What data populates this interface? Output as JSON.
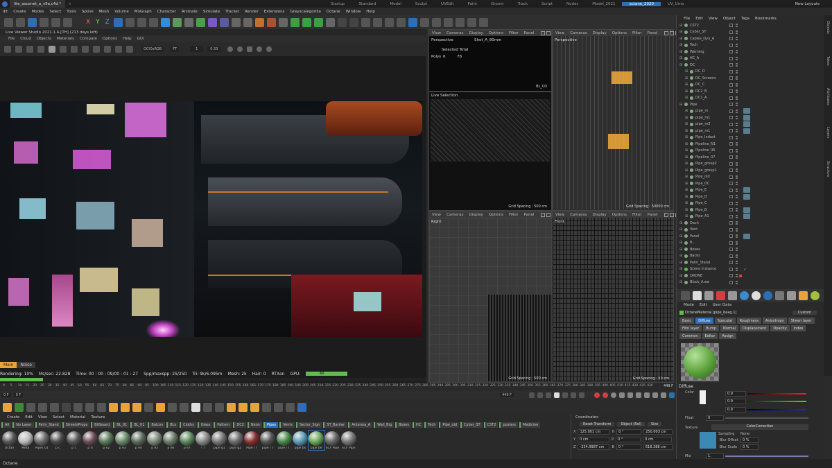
{
  "titlebar": {
    "file_tab": "lite_ascenet_a_v9a.c4d *",
    "layouts": [
      "Startup",
      "Standard",
      "Model",
      "Sculpt",
      "UVEdit",
      "Paint",
      "Groom",
      "Track",
      "Script",
      "Nodes",
      "Model_2021",
      "octane_2020",
      "UV_Uma"
    ],
    "active_layout": "octane_2020",
    "new_layouts": "New Layouts"
  },
  "main_menu": [
    "dit",
    "Create",
    "Modes",
    "Select",
    "Tools",
    "Spline",
    "Mesh",
    "Volume",
    "MoGraph",
    "Character",
    "Animate",
    "Simulate",
    "Tracker",
    "Render",
    "Extensions",
    "Greyscalegorilla",
    "Octane",
    "Window",
    "Help"
  ],
  "live_viewer": {
    "title": "Live Viewer Studio 2021.1.4-[TH] (213 days left)",
    "menu": [
      "File",
      "Cloud",
      "Objects",
      "Materials",
      "Compare",
      "Options",
      "Help",
      "GUI"
    ],
    "colorspace": "OCIOsRGB",
    "mode": "FT",
    "value1": "1",
    "value2": "0.33",
    "tabs": [
      "Main",
      "Noise"
    ],
    "status": {
      "rendering": "Rendering: 10%",
      "ms": "Ms/sec: 22.828",
      "time": "Time: 00 : 00 : 09/00 : 01 : 27",
      "spp": "Spp/maxspp: 25/250",
      "tri": "Tri: 9k/6.095m",
      "mesh": "Mesh: 2k",
      "hair": "Hair: 0",
      "rtx": "RTXon",
      "gpu": "GPU:",
      "gpu_val": "60"
    }
  },
  "viewports": {
    "menu": [
      "View",
      "Cameras",
      "Display",
      "Options",
      "Filter",
      "Panel"
    ],
    "tl": {
      "label": "Perspective",
      "camera": "Shot_A_80mm",
      "sel_title": "Selected Total",
      "polys": "Polys",
      "polys_a": "6",
      "polys_b": "78",
      "corner": "BL_O3"
    },
    "tl2": {
      "label": "Live Selection",
      "grid": "Grid Spacing : 500 cm"
    },
    "tr": {
      "label": "Perspective",
      "grid": "Grid Spacing : 50000 cm"
    },
    "bl": {
      "label": "Right",
      "grid": "Grid Spacing : 500 cm"
    },
    "br": {
      "label": "Front",
      "grid": "Grid Spacing : 50 cm"
    }
  },
  "object_manager": {
    "menu": [
      "File",
      "Edit",
      "View",
      "Object",
      "Tags",
      "Bookmarks"
    ],
    "objects": [
      "CST2",
      "Cyber_ST",
      "Cables_Dyn_A",
      "Tech",
      "Warning",
      "HC_A",
      "DC",
      "DC_D",
      "DC_Screens",
      "DC_C",
      "DC2_B",
      "DC2_A",
      "Pipe",
      "pipe_m",
      "pipe_m1",
      "pipe_m3",
      "pipe_m1",
      "Pipe_Indust",
      "Pipeline_N1",
      "Pipeline_06",
      "Pipeline_07",
      "Pipe_group2",
      "Pipe_group1",
      "Pipe_old",
      "Pipe_OC",
      "Pipe_E",
      "Pipe_D",
      "Pipe_C",
      "Pipe_B",
      "Pipe_A1",
      "Dach",
      "Vent",
      "Panel",
      "8...",
      "Boxes",
      "Backs",
      "Palm_Stand",
      "Scene Instance",
      "ORDNE",
      "Block_A.ew"
    ]
  },
  "side_tabs": [
    "Objects",
    "Takes",
    "Attributes",
    "Layers",
    "Structure"
  ],
  "timeline": {
    "ticks": [
      "0",
      "5",
      "10",
      "15",
      "20",
      "25",
      "30",
      "35",
      "40",
      "45",
      "50",
      "55",
      "60",
      "65",
      "70",
      "75",
      "80",
      "85",
      "90",
      "95",
      "100",
      "105",
      "110",
      "115",
      "120",
      "125",
      "130",
      "135",
      "140",
      "145",
      "150",
      "155",
      "160",
      "165",
      "170",
      "175",
      "180",
      "185",
      "190",
      "195",
      "200",
      "205",
      "210",
      "215",
      "220",
      "225",
      "230",
      "235",
      "240",
      "245",
      "250",
      "255",
      "260",
      "265",
      "270",
      "275",
      "280",
      "285",
      "290",
      "295",
      "300",
      "305",
      "310",
      "315",
      "320",
      "325",
      "330",
      "335",
      "340",
      "345",
      "350",
      "355",
      "360",
      "365",
      "370",
      "375",
      "380",
      "385",
      "390",
      "395",
      "400",
      "405",
      "410",
      "415",
      "420",
      "425",
      "430"
    ],
    "current": "449 F",
    "current2": "449 F",
    "start": "0 F",
    "start2": "0 F"
  },
  "material_manager": {
    "menu": [
      "Create",
      "Edit",
      "View",
      "Select",
      "Material",
      "Texture"
    ],
    "layers": [
      "All",
      "No Layer",
      "Palm_Stand",
      "StreetsProps",
      "Billboard",
      "BL_01",
      "BL_01",
      "Balcon",
      "BLs",
      "Cloths",
      "Glass",
      "Pattern",
      "DC2",
      "Neon",
      "Pipes",
      "Vents",
      "Sector_Sign",
      "ST_Barrier",
      "Antenna_A",
      "Wall_Big",
      "Boxes",
      "HC",
      "Tech",
      "Pipe_old",
      "Cyber_ST",
      "CST2",
      "posters",
      "Medicine"
    ],
    "active_layer": "Pipes",
    "materials": [
      {
        "name": "Octan",
        "color": "#555"
      },
      {
        "name": "Meta",
        "color": "#bbb"
      },
      {
        "name": "Pipes 01",
        "color": "#6a6a6a"
      },
      {
        "name": "p c",
        "color": "#4a4a4a"
      },
      {
        "name": "p c",
        "color": "#555"
      },
      {
        "name": "p d",
        "color": "#6a4a55"
      },
      {
        "name": "p e2",
        "color": "#5a7a5a"
      },
      {
        "name": "p e3",
        "color": "#6a8a6a"
      },
      {
        "name": "p e4",
        "color": "#5a6a5a"
      },
      {
        "name": "p e5",
        "color": "#7a8a7a"
      },
      {
        "name": "p e6",
        "color": "#6a7a6a"
      },
      {
        "name": "p e7",
        "color": "#5a8a5a"
      },
      {
        "name": "! 7",
        "color": "#888"
      },
      {
        "name": "pipe g1",
        "color": "#777"
      },
      {
        "name": "pipe g2",
        "color": "#6a6a6a"
      },
      {
        "name": "Pipe / f",
        "color": "#8a3030"
      },
      {
        "name": "pipe / 7",
        "color": "#555"
      },
      {
        "name": "pipe l T",
        "color": "#4a8a4a"
      },
      {
        "name": "pipe bs",
        "color": "#5a9ab5"
      },
      {
        "name": "pipe be",
        "color": "#6aaa5a"
      },
      {
        "name": "SCF Pipe",
        "color": "#666"
      },
      {
        "name": "SCF Pipe",
        "color": "#777"
      }
    ],
    "selected_material": "pipe be"
  },
  "coordinates": {
    "title": "Coordinates",
    "reset": "Reset Transform",
    "mode": "Object (Rel)",
    "size_label": "Size",
    "rows": [
      {
        "axis": "X",
        "pos": "125.001 cm",
        "rot_axis": "H",
        "rot": "0 °",
        "size": "250.003 cm"
      },
      {
        "axis": "Y",
        "pos": "0 cm",
        "rot_axis": "P",
        "rot": "0 °",
        "size": "0 cm"
      },
      {
        "axis": "Z",
        "pos": "-234.9987 cm",
        "rot_axis": "B",
        "rot": "0 °",
        "size": "618.388 cm"
      }
    ]
  },
  "attributes": {
    "menu": [
      "Mode",
      "Edit",
      "User Data"
    ],
    "title": "OctaneMaterial [pipe_beag.1]",
    "custom": "Custom",
    "tabs": [
      "Basic",
      "Diffuse",
      "Specular",
      "Roughness",
      "Anisotropy",
      "Sheen layer",
      "Film layer",
      "Bump",
      "Normal",
      "Displacement",
      "Opacity",
      "Index",
      "Common",
      "Editor",
      "Assign"
    ],
    "active_tab": "Diffuse",
    "diffuse_label": "Diffuse",
    "color_label": "Color",
    "r_val": "0.9",
    "g_val": "0.9",
    "b_val": "0.9",
    "float_label": "Float",
    "float_val": "0",
    "texture_label": "Texture",
    "color_correction": "ColorCorrection",
    "sampling": "Sampling",
    "sampling_val": "None",
    "blur_offset": "Blur Offset",
    "blur_offset_val": "0 %",
    "blur_scale": "Blur Scale",
    "blur_scale_val": "0 %",
    "mix_label": "Mix",
    "mix_val": "1."
  },
  "status_bar": "Octane",
  "colors": {
    "accent": "#2d6fb7",
    "orange": "#e8a43a",
    "green": "#5fbf4a"
  }
}
